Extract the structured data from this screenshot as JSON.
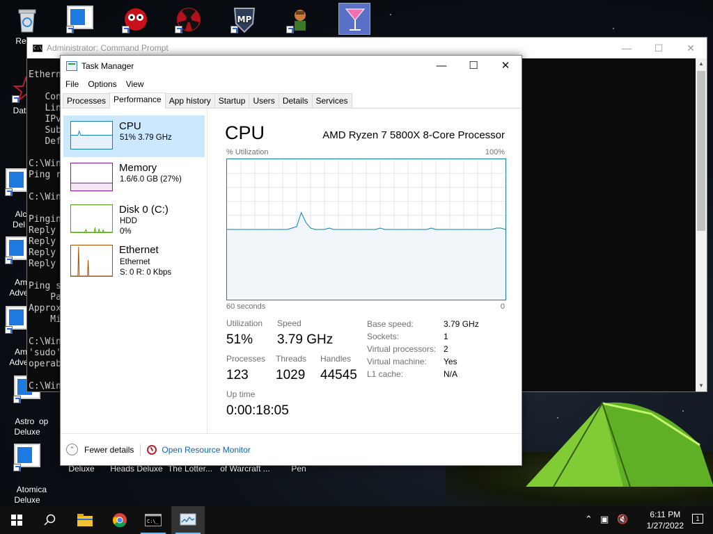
{
  "desktop": {
    "icons_left": [
      {
        "label": "Recyc"
      },
      {
        "label": "DataW"
      },
      {
        "label": "Alch\nDel"
      },
      {
        "label": "Ama\nAdve"
      },
      {
        "label": "Ama\nAdve"
      },
      {
        "label": "Astro  op\nDeluxe"
      },
      {
        "label": "Atomica\nDeluxe"
      }
    ],
    "bottom_labels": [
      "Deluxe",
      "Heads Deluxe",
      "The Lotter...",
      "of Warcraft ...",
      "Pen"
    ]
  },
  "cmd": {
    "title": "Administrator: Command Prompt",
    "lines": [
      "",
      "Ethern",
      "",
      "   Con",
      "   Lin",
      "   IPv",
      "   Sub",
      "   Def",
      "",
      "C:\\Win",
      "Ping r",
      "",
      "C:\\Win",
      "",
      "Pingin",
      "Reply ",
      "Reply ",
      "Reply ",
      "Reply ",
      "",
      "Ping s",
      "    Pa",
      "Approx",
      "    Mi",
      "",
      "C:\\Win",
      "'sudo'",
      "operab",
      "",
      "C:\\Win"
    ]
  },
  "taskmanager": {
    "title": "Task Manager",
    "menu": [
      "File",
      "Options",
      "View"
    ],
    "tabs": [
      "Processes",
      "Performance",
      "App history",
      "Startup",
      "Users",
      "Details",
      "Services"
    ],
    "active_tab": "Performance",
    "resources": [
      {
        "name": "CPU",
        "line2": "51%  3.79 GHz",
        "line3": "",
        "color": "#117dbb",
        "selected": true
      },
      {
        "name": "Memory",
        "line2": "1.6/6.0 GB (27%)",
        "line3": "",
        "color": "#8b12ae",
        "selected": false
      },
      {
        "name": "Disk 0 (C:)",
        "line2": "HDD",
        "line3": "0%",
        "color": "#4da60c",
        "selected": false
      },
      {
        "name": "Ethernet",
        "line2": "Ethernet",
        "line3": "S: 0  R: 0 Kbps",
        "color": "#a74f01",
        "selected": false
      }
    ],
    "cpu": {
      "title": "CPU",
      "processor": "AMD Ryzen 7 5800X 8-Core Processor",
      "util_label": "% Utilization",
      "util_max": "100%",
      "time_label": "60 seconds",
      "time_zero": "0",
      "graph_color": "#117dbb",
      "history": [
        50,
        50,
        50,
        50,
        50,
        50,
        50,
        50,
        50,
        50,
        50,
        50,
        50,
        50,
        51,
        52,
        62,
        55,
        51,
        50,
        50,
        50,
        51,
        50,
        50,
        50,
        50,
        50,
        50,
        50,
        50,
        50,
        50,
        51,
        50,
        50,
        50,
        50,
        50,
        50,
        50,
        50,
        50,
        50,
        51,
        50,
        50,
        50,
        50,
        50,
        50,
        50,
        50,
        50,
        50,
        50,
        50,
        50,
        51,
        51,
        50
      ],
      "utilization_label": "Utilization",
      "utilization_value": "51%",
      "speed_label": "Speed",
      "speed_value": "3.79 GHz",
      "processes_label": "Processes",
      "processes_value": "123",
      "threads_label": "Threads",
      "threads_value": "1029",
      "handles_label": "Handles",
      "handles_value": "44545",
      "uptime_label": "Up time",
      "uptime_value": "0:00:18:05",
      "details": [
        {
          "k": "Base speed:",
          "v": "3.79 GHz"
        },
        {
          "k": "Sockets:",
          "v": "1"
        },
        {
          "k": "Virtual processors:",
          "v": "2"
        },
        {
          "k": "Virtual machine:",
          "v": "Yes"
        },
        {
          "k": "L1 cache:",
          "v": "N/A"
        }
      ]
    },
    "footer": {
      "fewer_details": "Fewer details",
      "open_resource_monitor": "Open Resource Monitor"
    }
  },
  "taskbar": {
    "time": "6:11 PM",
    "date": "1/27/2022",
    "notifications": "1"
  }
}
